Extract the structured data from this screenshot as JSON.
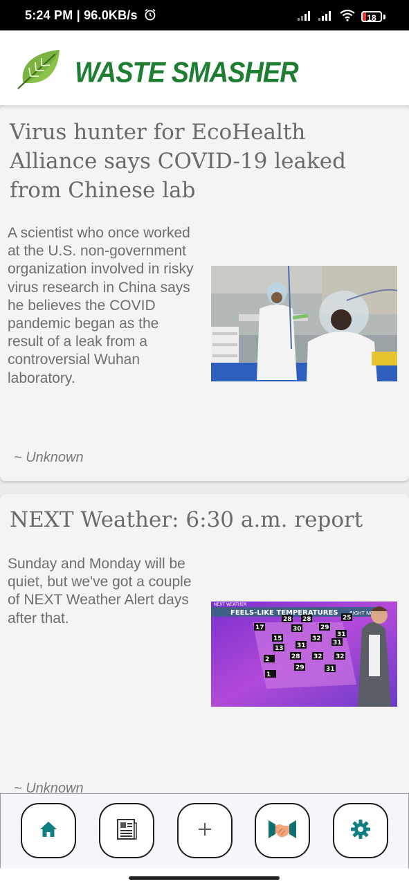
{
  "status_bar": {
    "time": "5:24 PM",
    "speed": "96.0KB/s",
    "battery": "18",
    "battery_level": 0.18,
    "icons": [
      "alarm-icon",
      "signal-icon",
      "signal-icon",
      "wifi-icon",
      "battery-icon"
    ]
  },
  "header": {
    "title": "WASTE SMASHER",
    "logo_icon": "leaf-icon",
    "title_color": "#1e7f33"
  },
  "articles": [
    {
      "title": "Virus hunter for EcoHealth Alliance says COVID-19 leaked from Chinese lab",
      "description": "A scientist who once worked at the U.S. non-government organization involved in risky virus research in China says he believes the COVID pandemic began as the result of a leak from a controversial Wuhan laboratory.",
      "author": "~ Unknown"
    },
    {
      "title": "NEXT Weather: 6:30 a.m. report",
      "description": "Sunday and Monday will be quiet, but we've got a couple of NEXT Weather Alert days after that.",
      "author": "~ Unknown",
      "image_text": {
        "banner": "FEELS-LIKE TEMPERATURES",
        "brand": "NEXT WEATHER",
        "corner": "RIGHT NO",
        "temps": [
          "28",
          "28",
          "25",
          "17",
          "30",
          "29",
          "31",
          "15",
          "32",
          "31",
          "13",
          "31",
          "32",
          "28",
          "32",
          "2",
          "29",
          "31",
          "1"
        ]
      }
    }
  ],
  "bottom_nav": {
    "items": [
      {
        "name": "home",
        "icon": "home-icon"
      },
      {
        "name": "news",
        "icon": "newspaper-icon"
      },
      {
        "name": "add",
        "icon": "plus-icon"
      },
      {
        "name": "community",
        "icon": "handshake-icon"
      },
      {
        "name": "settings",
        "icon": "gear-icon"
      }
    ],
    "accent": "#0f7f82"
  }
}
